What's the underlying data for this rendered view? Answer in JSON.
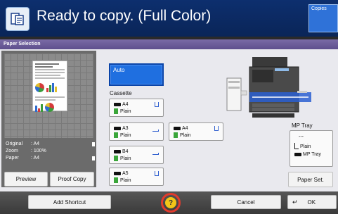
{
  "header": {
    "title": "Ready to copy. (Full Color)",
    "copies_label": "Copies",
    "icon": "copy-mode-icon"
  },
  "panel": {
    "title": "Paper Selection"
  },
  "preview": {
    "info": [
      {
        "key": "Original",
        "value": ": A4"
      },
      {
        "key": "Zoom",
        "value": ": 100%"
      },
      {
        "key": "Paper",
        "value": ": A4"
      }
    ],
    "preview_button": "Preview",
    "proof_copy_button": "Proof Copy"
  },
  "paper": {
    "auto": "Auto",
    "cassette_label": "Cassette",
    "cassettes": [
      {
        "size": "A4",
        "type": "Plain"
      },
      {
        "size": "A3",
        "type": "Plain"
      },
      {
        "size": "A4",
        "type": "Plain"
      },
      {
        "size": "B4",
        "type": "Plain"
      },
      {
        "size": "A5",
        "type": "Plain"
      }
    ],
    "mp_tray_label": "MP Tray",
    "mp_tray": {
      "size": "---",
      "type": "Plain",
      "name": "MP Tray"
    },
    "paper_set_button": "Paper Set."
  },
  "footer": {
    "add_shortcut": "Add Shortcut",
    "help": "?",
    "cancel": "Cancel",
    "ok": "OK"
  },
  "colors": {
    "header_bg": "#0d2f6e",
    "panel_title_bg": "#6a5b98",
    "accent": "#1f6fe0",
    "help_ring": "#e23b2d",
    "help_bg": "#f2c518"
  }
}
